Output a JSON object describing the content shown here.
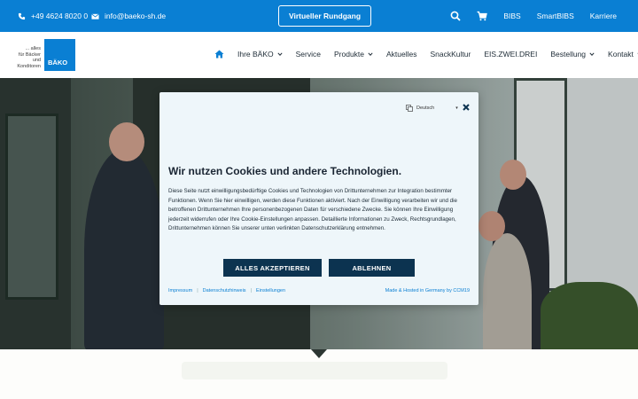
{
  "topbar": {
    "phone": "+49 4624 8020 0",
    "email": "info@baeko-sh.de",
    "tour_button": "Virtueller Rundgang",
    "links": [
      "BIBS",
      "SmartBIBS",
      "Karriere"
    ],
    "icons": [
      "phone-icon",
      "mail-icon",
      "search-icon",
      "cart-icon"
    ]
  },
  "logo": {
    "tagline_lines": [
      "... alles",
      "für Bäcker",
      "und",
      "Konditoren"
    ],
    "brand": "BÄKO"
  },
  "nav": {
    "items": [
      {
        "label": "Ihre BÄKO",
        "dropdown": true
      },
      {
        "label": "Service",
        "dropdown": false
      },
      {
        "label": "Produkte",
        "dropdown": true
      },
      {
        "label": "Aktuelles",
        "dropdown": false
      },
      {
        "label": "SnackKultur",
        "dropdown": false
      },
      {
        "label": "EIS.ZWEI.DREI",
        "dropdown": false
      },
      {
        "label": "Bestellung",
        "dropdown": true
      },
      {
        "label": "Kontakt",
        "dropdown": true
      }
    ]
  },
  "cookie": {
    "language": "Deutsch",
    "title": "Wir nutzen Cookies und andere Technologien.",
    "body": "Diese Seite nutzt einwilligungsbedürftige Cookies und Technologien von Drittunternehmen zur Integration bestimmter Funktionen. Wenn Sie hier einwilligen, werden diese Funktionen aktiviert. Nach der Einwilligung verarbeiten wir und die betroffenen Drittunternehmen Ihre personenbezogenen Daten für verschiedene Zwecke. Sie können Ihre Einwilligung jederzeit widerrufen oder Ihre Cookie-Einstellungen anpassen. Detaillierte Informationen zu Zweck, Rechtsgrundlagen, Drittunternehmen können Sie unserer unten verlinkten Datenschutzerklärung entnehmen.",
    "accept": "ALLES AKZEPTIEREN",
    "decline": "ABLEHNEN",
    "links": [
      "Impressum",
      "Datenschutzhinweis",
      "Einstellungen"
    ],
    "hosted": "Made & Hosted in Germany by CCM19"
  },
  "colors": {
    "brand_blue": "#0a7fd3",
    "button_navy": "#0c3350",
    "dialog_bg": "#eef6fa"
  }
}
